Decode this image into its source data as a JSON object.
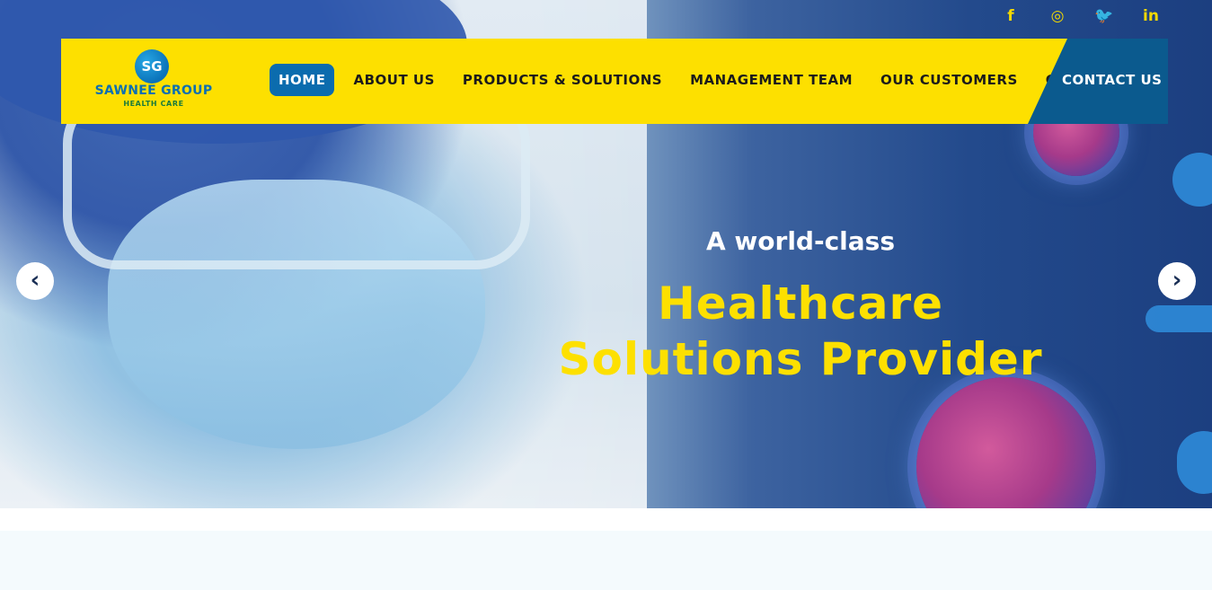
{
  "social": {
    "facebook": "f",
    "instagram": "◎",
    "twitter": "🐦",
    "linkedin": "in",
    "color": "#f2d800"
  },
  "brand": {
    "mark": "SG",
    "name": "SAWNEE GROUP",
    "tagline": "HEALTH CARE"
  },
  "nav": {
    "items": [
      {
        "label": "HOME",
        "active": true
      },
      {
        "label": "ABOUT US"
      },
      {
        "label": "PRODUCTS & SOLUTIONS"
      },
      {
        "label": "MANAGEMENT TEAM"
      },
      {
        "label": "OUR CUSTOMERS"
      },
      {
        "label": "CAREERS"
      }
    ],
    "contact": "CONTACT US",
    "bar_color": "#fde000",
    "active_color": "#0b6cae",
    "contact_color": "#0b5a8e"
  },
  "hero": {
    "subtitle": "A world-class",
    "title": "Healthcare Solutions Provider",
    "prev_icon": "‹",
    "next_icon": "›"
  }
}
